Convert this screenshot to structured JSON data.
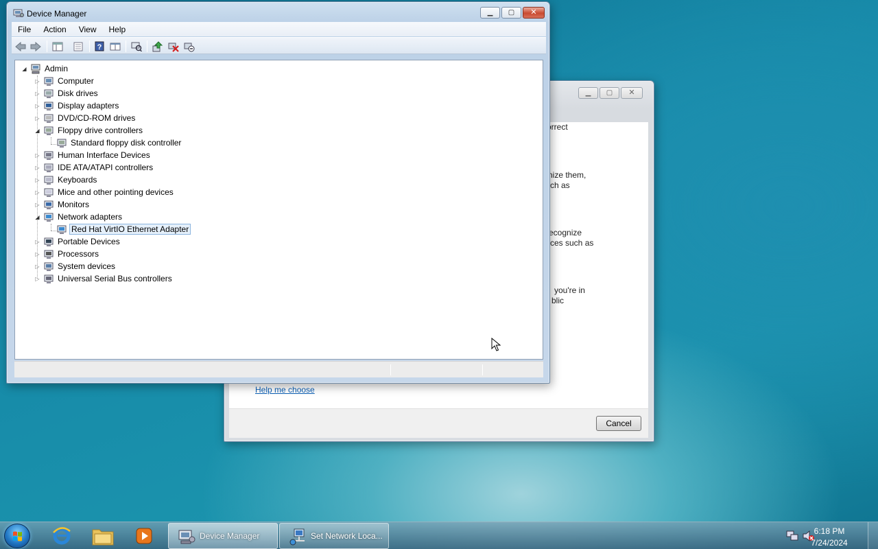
{
  "colors": {
    "desktop": "#1b8fab",
    "selection_bg": "#e5f0fb",
    "selection_border": "#8bb4de",
    "link": "#0b5fb5",
    "close_button": "#c94a30"
  },
  "device_manager": {
    "title": "Device Manager",
    "icon": "device-manager-icon",
    "menu": [
      "File",
      "Action",
      "View",
      "Help"
    ],
    "toolbar": [
      "back-icon",
      "forward-icon",
      "show-hide-console-tree-icon",
      "properties-icon",
      "help-icon",
      "view-icon",
      "scan-hardware-icon",
      "update-driver-icon",
      "uninstall-icon",
      "disable-device-icon"
    ],
    "tree": {
      "root": "Admin",
      "categories": [
        {
          "label": "Computer",
          "icon": "computer-icon",
          "expanded": false
        },
        {
          "label": "Disk drives",
          "icon": "disk-drive-icon",
          "expanded": false
        },
        {
          "label": "Display adapters",
          "icon": "display-adapter-icon",
          "expanded": false
        },
        {
          "label": "DVD/CD-ROM drives",
          "icon": "dvd-drive-icon",
          "expanded": false
        },
        {
          "label": "Floppy drive controllers",
          "icon": "floppy-controller-icon",
          "expanded": true,
          "children": [
            {
              "label": "Standard floppy disk controller",
              "icon": "floppy-controller-icon"
            }
          ]
        },
        {
          "label": "Human Interface Devices",
          "icon": "hid-icon",
          "expanded": false
        },
        {
          "label": "IDE ATA/ATAPI controllers",
          "icon": "ide-controller-icon",
          "expanded": false
        },
        {
          "label": "Keyboards",
          "icon": "keyboard-icon",
          "expanded": false
        },
        {
          "label": "Mice and other pointing devices",
          "icon": "mouse-icon",
          "expanded": false
        },
        {
          "label": "Monitors",
          "icon": "monitor-icon",
          "expanded": false
        },
        {
          "label": "Network adapters",
          "icon": "network-adapter-icon",
          "expanded": true,
          "children": [
            {
              "label": "Red Hat VirtIO Ethernet Adapter",
              "icon": "network-adapter-icon",
              "selected": true
            }
          ]
        },
        {
          "label": "Portable Devices",
          "icon": "portable-device-icon",
          "expanded": false
        },
        {
          "label": "Processors",
          "icon": "processor-icon",
          "expanded": false
        },
        {
          "label": "System devices",
          "icon": "system-device-icon",
          "expanded": false
        },
        {
          "label": "Universal Serial Bus controllers",
          "icon": "usb-icon",
          "expanded": false
        }
      ]
    }
  },
  "network_dialog": {
    "text_fragments": [
      "orrect",
      "nize them,",
      "ch as",
      "ecognize",
      "ces such as",
      "you're in",
      "blic"
    ],
    "help_link": "Help me choose",
    "cancel_button": "Cancel"
  },
  "taskbar": {
    "pinned": [
      "internet-explorer-icon",
      "file-explorer-icon",
      "media-player-icon"
    ],
    "tasks": [
      {
        "label": "Device Manager",
        "icon": "device-manager-icon",
        "active": true
      },
      {
        "label": "Set Network Loca...",
        "icon": "network-location-icon",
        "active": false
      }
    ],
    "tray_icons": [
      "network-icon",
      "volume-muted-icon"
    ],
    "clock": {
      "time": "6:18 PM",
      "date": "7/24/2024"
    }
  }
}
